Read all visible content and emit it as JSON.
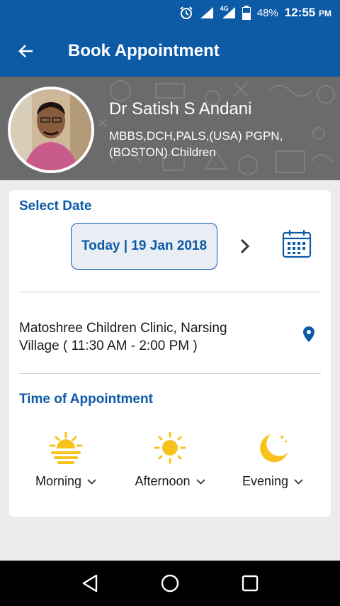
{
  "status_bar": {
    "battery": "48%",
    "time": "12:55",
    "ampm": "PM",
    "network": "4G"
  },
  "app_bar": {
    "title": "Book Appointment"
  },
  "doctor": {
    "name": "Dr Satish S Andani",
    "qualifications": "MBBS,DCH,PALS,(USA) PGPN,(BOSTON) Children"
  },
  "select_date": {
    "heading": "Select Date",
    "date_label": "Today | 19 Jan 2018"
  },
  "clinic": {
    "line1": "Matoshree Children Clinic, Narsing",
    "line2": "Village ( 11:30 AM - 2:00 PM )"
  },
  "time_of_appointment": {
    "heading": "Time of Appointment",
    "slots": [
      {
        "label": "Morning",
        "icon": "sunrise-icon"
      },
      {
        "label": "Afternoon",
        "icon": "sun-icon"
      },
      {
        "label": "Evening",
        "icon": "moon-icon"
      }
    ]
  },
  "colors": {
    "primary": "#0d5aa7",
    "accent_icon": "#f7c21b",
    "background": "#ececec"
  }
}
